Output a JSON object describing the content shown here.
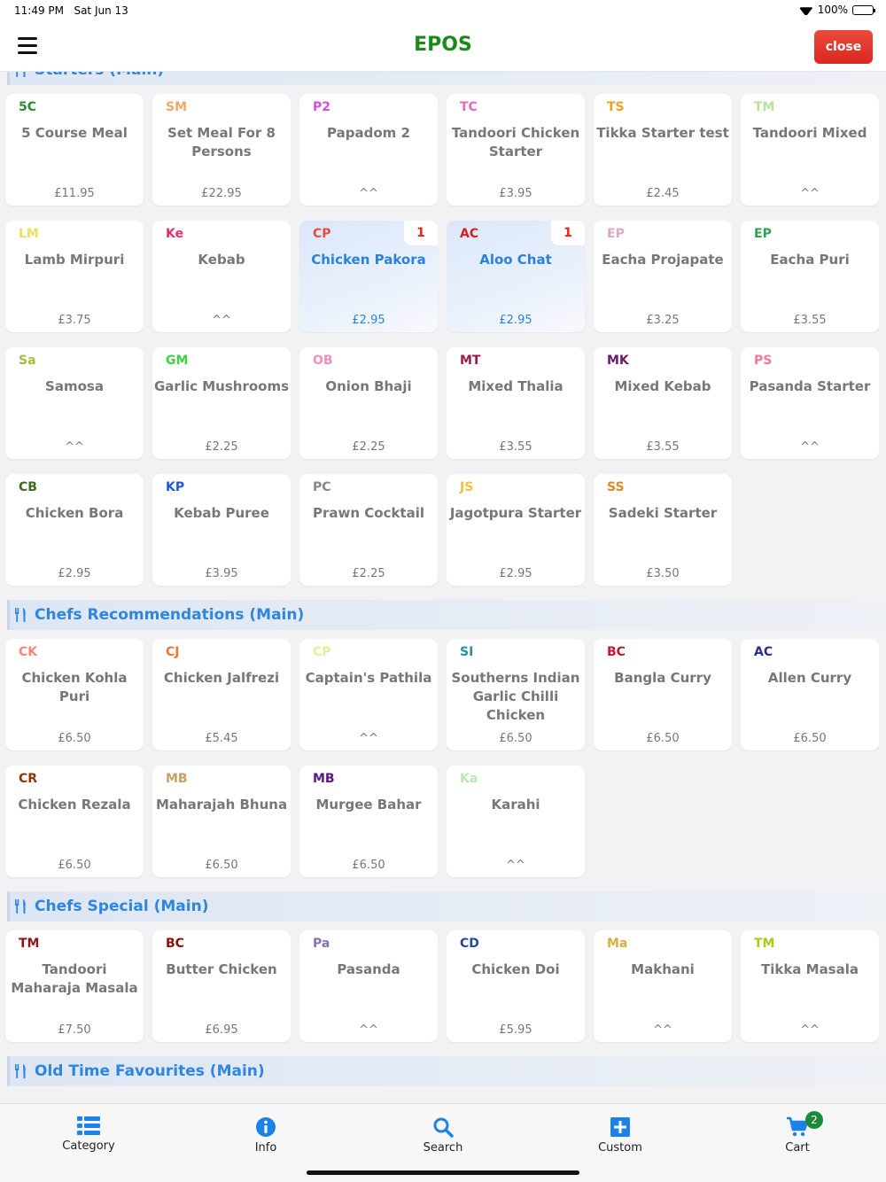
{
  "status": {
    "time": "11:49 PM",
    "date": "Sat Jun 13",
    "battery": "100%"
  },
  "header": {
    "title": "EPOS",
    "close_label": "close"
  },
  "colors": {
    "title": "#1a8a1a",
    "close": "#e0352b",
    "section": "#2e86de",
    "selected": "#2a82dc",
    "qty": "#e0261c"
  },
  "sections": [
    {
      "title": "Starters (Main)",
      "items": [
        {
          "code": "5C",
          "color": "#2e8b2e",
          "name": "5 Course Meal",
          "price": "£11.95"
        },
        {
          "code": "SM",
          "color": "#f0a868",
          "name": "Set Meal For 8 Persons",
          "price": "£22.95"
        },
        {
          "code": "P2",
          "color": "#d64fd6",
          "name": "Papadom 2",
          "price": "^^"
        },
        {
          "code": "TC",
          "color": "#e666c4",
          "name": "Tandoori Chicken Starter",
          "price": "£3.95"
        },
        {
          "code": "TS",
          "color": "#f0a020",
          "name": "Tikka Starter test",
          "price": "£2.45"
        },
        {
          "code": "TM",
          "color": "#b8e0a0",
          "name": "Tandoori Mixed",
          "price": "^^"
        },
        {
          "code": "LM",
          "color": "#ece060",
          "name": "Lamb Mirpuri",
          "price": "£3.75"
        },
        {
          "code": "Ke",
          "color": "#e0306a",
          "name": "Kebab",
          "price": "^^"
        },
        {
          "code": "CP",
          "color": "#e84a4a",
          "name": "Chicken Pakora",
          "price": "£2.95",
          "qty": "1",
          "selected": true
        },
        {
          "code": "AC",
          "color": "#d42020",
          "name": "Aloo Chat",
          "price": "£2.95",
          "qty": "1",
          "selected": true
        },
        {
          "code": "EP",
          "color": "#e0a8c0",
          "name": "Eacha Projapate",
          "price": "£3.25"
        },
        {
          "code": "EP",
          "color": "#30a050",
          "name": "Eacha Puri",
          "price": "£3.55"
        },
        {
          "code": "Sa",
          "color": "#a0c040",
          "name": "Samosa",
          "price": "^^"
        },
        {
          "code": "GM",
          "color": "#40d040",
          "name": "Garlic Mushrooms",
          "price": "£2.25"
        },
        {
          "code": "OB",
          "color": "#f090c0",
          "name": "Onion Bhaji",
          "price": "£2.25"
        },
        {
          "code": "MT",
          "color": "#a01848",
          "name": "Mixed Thalia",
          "price": "£3.55"
        },
        {
          "code": "MK",
          "color": "#6a1868",
          "name": "Mixed Kebab",
          "price": "£3.55"
        },
        {
          "code": "PS",
          "color": "#f07898",
          "name": "Pasanda Starter",
          "price": "^^"
        },
        {
          "code": "CB",
          "color": "#3a6a1a",
          "name": "Chicken Bora",
          "price": "£2.95"
        },
        {
          "code": "KP",
          "color": "#1a5ad8",
          "name": "Kebab Puree",
          "price": "£3.95"
        },
        {
          "code": "PC",
          "color": "#888888",
          "name": "Prawn Cocktail",
          "price": "£2.25"
        },
        {
          "code": "JS",
          "color": "#f0c040",
          "name": "Jagotpura Starter",
          "price": "£2.95"
        },
        {
          "code": "SS",
          "color": "#e08828",
          "name": "Sadeki Starter",
          "price": "£3.50"
        }
      ]
    },
    {
      "title": "Chefs Recommendations (Main)",
      "items": [
        {
          "code": "CK",
          "color": "#f08878",
          "name": "Chicken Kohla Puri",
          "price": "£6.50"
        },
        {
          "code": "CJ",
          "color": "#e87830",
          "name": "Chicken Jalfrezi",
          "price": "£5.45"
        },
        {
          "code": "CP",
          "color": "#e8ec98",
          "name": "Captain's Pathila",
          "price": "^^"
        },
        {
          "code": "SI",
          "color": "#2890a0",
          "name": "Southerns Indian Garlic Chilli Chicken",
          "price": "£6.50"
        },
        {
          "code": "BC",
          "color": "#c01830",
          "name": "Bangla Curry",
          "price": "£6.50"
        },
        {
          "code": "AC",
          "color": "#28308a",
          "name": "Allen Curry",
          "price": "£6.50"
        },
        {
          "code": "CR",
          "color": "#8a3808",
          "name": "Chicken Rezala",
          "price": "£6.50"
        },
        {
          "code": "MB",
          "color": "#c8a068",
          "name": "Maharajah Bhuna",
          "price": "£6.50"
        },
        {
          "code": "MB",
          "color": "#5a1880",
          "name": "Murgee Bahar",
          "price": "£6.50"
        },
        {
          "code": "Ka",
          "color": "#b8e8b8",
          "name": "Karahi",
          "price": "^^"
        }
      ]
    },
    {
      "title": "Chefs Special (Main)",
      "items": [
        {
          "code": "TM",
          "color": "#8a1818",
          "name": "Tandoori Maharaja Masala",
          "price": "£7.50"
        },
        {
          "code": "BC",
          "color": "#8a1010",
          "name": "Butter Chicken",
          "price": "£6.95"
        },
        {
          "code": "Pa",
          "color": "#8a70b0",
          "name": "Pasanda",
          "price": "^^"
        },
        {
          "code": "CD",
          "color": "#284898",
          "name": "Chicken Doi",
          "price": "£5.95"
        },
        {
          "code": "Ma",
          "color": "#d8b040",
          "name": "Makhani",
          "price": "^^"
        },
        {
          "code": "TM",
          "color": "#b0c818",
          "name": "Tikka Masala",
          "price": "^^"
        }
      ]
    },
    {
      "title": "Old Time Favourites (Main)",
      "items": []
    }
  ],
  "tabs": [
    {
      "label": "Category",
      "icon": "category-list-icon"
    },
    {
      "label": "Info",
      "icon": "info-icon"
    },
    {
      "label": "Search",
      "icon": "search-icon"
    },
    {
      "label": "Custom",
      "icon": "plus-square-icon"
    },
    {
      "label": "Cart",
      "icon": "cart-icon",
      "badge": "2"
    }
  ]
}
